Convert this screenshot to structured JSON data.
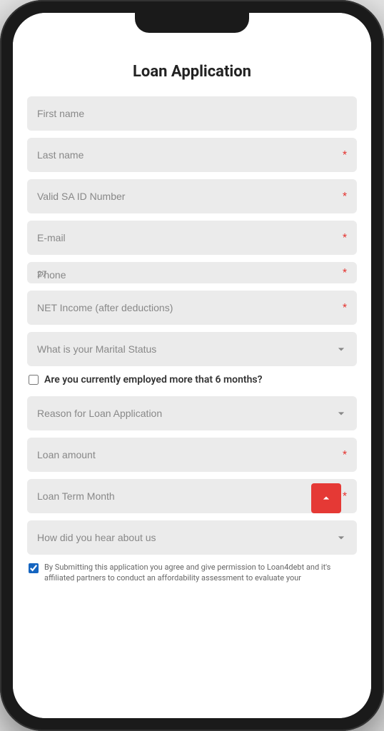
{
  "page": {
    "title": "Loan Application"
  },
  "form": {
    "first_name_placeholder": "First name",
    "last_name_placeholder": "Last name",
    "last_name_required": "*",
    "id_number_placeholder": "Valid SA ID Number",
    "id_number_required": "*",
    "email_placeholder": "E-mail",
    "email_required": "*",
    "phone_placeholder": "Phone",
    "phone_required": "*",
    "phone_prefix": "27",
    "net_income_placeholder": "NET Income (after deductions)",
    "net_income_required": "*",
    "marital_status_placeholder": "What is your Marital Status",
    "marital_status_required": "*",
    "employment_label": "Are you currently employed more that 6 months?",
    "loan_reason_placeholder": "Reason for Loan Application",
    "loan_reason_required": "*",
    "loan_amount_placeholder": "Loan amount",
    "loan_amount_required": "*",
    "loan_term_placeholder": "Loan Term Month",
    "loan_term_required": "*",
    "hear_about_placeholder": "How did you hear about us",
    "consent_text": "By Submitting this application you agree and give permission to Loan4debt and it's affiliated partners to conduct an affordability assessment to evaluate your"
  },
  "icons": {
    "chevron_down": "▾",
    "chevron_up": "▲"
  }
}
